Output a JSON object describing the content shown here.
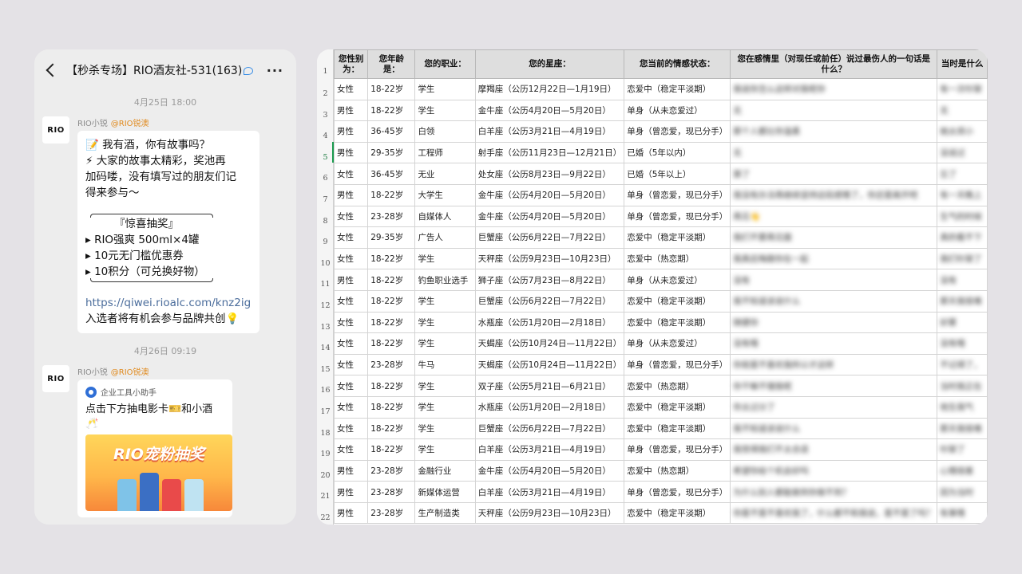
{
  "chat": {
    "title": "【秒杀专场】RIO酒友社-531(163)",
    "date1": "4月25日 18:00",
    "date2": "4月26日 09:19",
    "avatar_text": "RIO",
    "sender_name": "RIO小锐",
    "sender_corp": "@RIO锐澳",
    "message1_lines": [
      "📝 我有酒，你有故事吗？",
      "⚡ 大家的故事太精彩，奖池再",
      "加码喽，没有填写过的朋友们记",
      "得来参与～",
      "",
      "『惊喜抽奖』",
      "▸ RIO强爽 500ml×4罐",
      "▸ 10元无门槛优惠券",
      "▸ 10积分（可兑换好物）",
      "",
      "https://qiwei.rioalc.com/knz2ig",
      "入选者将有机会参与品牌共创💡"
    ],
    "card_source": "企业工具小助手",
    "card_text": "点击下方抽电影卡🎫和小酒🥂",
    "card_banner": "RIO宠粉抽奖"
  },
  "sheet": {
    "headers": [
      "您性别为：",
      "您年龄是：",
      "您的职业：",
      "您的星座：",
      "您当前的情感状态：",
      "您在感情里（对现任或前任）说过最伤人的一句话是什么？",
      "当时是什么"
    ],
    "row_numbers": [
      "1",
      "2",
      "3",
      "4",
      "5",
      "6",
      "7",
      "8",
      "9",
      "10",
      "11",
      "12",
      "13",
      "14",
      "15",
      "16",
      "17",
      "18",
      "19",
      "20",
      "21",
      "22"
    ],
    "active_row": "5",
    "rows": [
      [
        "女性",
        "18-22岁",
        "学生",
        "摩羯座（公历12月22日—1月19日）",
        "恋爱中（稳定平淡期）",
        "我说你怎么这样对我呢你",
        "有一次吵架"
      ],
      [
        "男性",
        "18-22岁",
        "学生",
        "金牛座（公历4月20日—5月20日）",
        "单身（从未恋爱过）",
        "无",
        "无"
      ],
      [
        "男性",
        "36-45岁",
        "白领",
        "白羊座（公历3月21日—4月19日）",
        "单身（曾恋爱，现已分手）",
        "那个人都比你温柔",
        "她太烦小"
      ],
      [
        "男性",
        "29-35岁",
        "工程师",
        "射手座（公历11月23日—12月21日）",
        "已婚（5年以内）",
        "无",
        "没说过"
      ],
      [
        "女性",
        "36-45岁",
        "无业",
        "处女座（公历8月23日—9月22日）",
        "已婚（5年以上）",
        "算了",
        "忘了"
      ],
      [
        "男性",
        "18-22岁",
        "大学生",
        "金牛座（公历4月20日—5月20日）",
        "单身（曾恋爱，现已分手）",
        "我没有办法再继续坚持这段感情了，你还是离开吧",
        "有一天晚上"
      ],
      [
        "女性",
        "23-28岁",
        "自媒体人",
        "金牛座（公历4月20日—5月20日）",
        "单身（曾恋爱，现已分手）",
        "再见👋",
        "生气的时候"
      ],
      [
        "女性",
        "29-35岁",
        "广告人",
        "巨蟹座（公历6月22日—7月22日）",
        "恋爱中（稳定平淡期）",
        "我们不要再见面",
        "真的看不下"
      ],
      [
        "女性",
        "18-22岁",
        "学生",
        "天秤座（公历9月23日—10月23日）",
        "恋爱中（热恋期）",
        "我真后悔跟你在一起",
        "我们吵架了"
      ],
      [
        "男性",
        "18-22岁",
        "钓鱼职业选手",
        "狮子座（公历7月23日—8月22日）",
        "单身（从未恋爱过）",
        "没有",
        "没有"
      ],
      [
        "女性",
        "18-22岁",
        "学生",
        "巨蟹座（公历6月22日—7月22日）",
        "恋爱中（稳定平淡期）",
        "我不知道该说什么",
        "那天我很难"
      ],
      [
        "女性",
        "18-22岁",
        "学生",
        "水瓶座（公历1月20日—2月18日）",
        "恋爱中（稳定平淡期）",
        "随便你",
        "好累"
      ],
      [
        "女性",
        "18-22岁",
        "学生",
        "天蝎座（公历10月24日—11月22日）",
        "单身（从未恋爱过）",
        "没有哦",
        "没有哦"
      ],
      [
        "女性",
        "23-28岁",
        "牛马",
        "天蝎座（公历10月24日—11月22日）",
        "单身（曾恋爱，现已分手）",
        "你就是不喜欢我所以才这样",
        "不记得了，"
      ],
      [
        "女性",
        "18-22岁",
        "学生",
        "双子座（公历5月21日—6月21日）",
        "恋爱中（热恋期）",
        "你干嘛不理我呢",
        "当时我正在"
      ],
      [
        "女性",
        "18-22岁",
        "学生",
        "水瓶座（公历1月20日—2月18日）",
        "恋爱中（稳定平淡期）",
        "你太过分了",
        "他生我气"
      ],
      [
        "女性",
        "18-22岁",
        "学生",
        "巨蟹座（公历6月22日—7月22日）",
        "恋爱中（稳定平淡期）",
        "我不知道该说什么",
        "那天我很难"
      ],
      [
        "女性",
        "18-22岁",
        "学生",
        "白羊座（公历3月21日—4月19日）",
        "单身（曾恋爱，现已分手）",
        "我觉得我们不太合适",
        "吵架了"
      ],
      [
        "男性",
        "23-28岁",
        "金融行业",
        "金牛座（公历4月20日—5月20日）",
        "恋爱中（热恋期）",
        "希望你给个机会好吗",
        "心情很差"
      ],
      [
        "男性",
        "23-28岁",
        "新媒体运营",
        "白羊座（公历3月21日—4月19日）",
        "单身（曾恋爱，现已分手）",
        "为什么别人都能做到你做不到？",
        "因为当时"
      ],
      [
        "男性",
        "23-28岁",
        "生产制造类",
        "天秤座（公历9月23日—10月23日）",
        "恋爱中（稳定平淡期）",
        "你是不是不喜欢我了，什么都不和我说，是不是了吗？",
        "有事情"
      ]
    ]
  }
}
